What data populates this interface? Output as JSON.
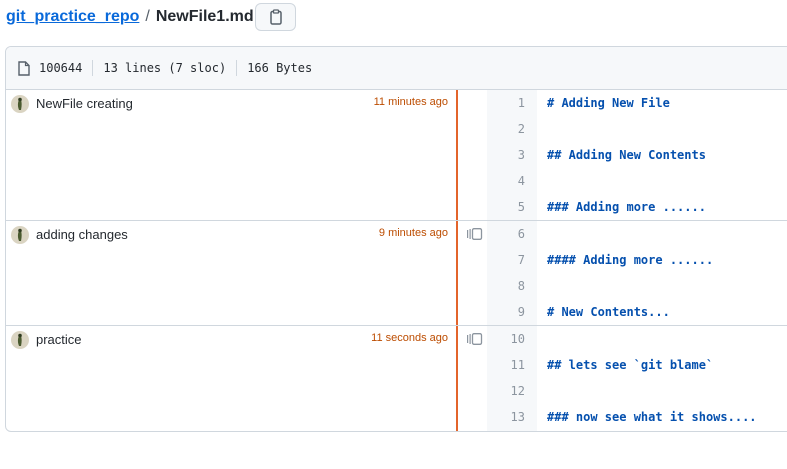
{
  "breadcrumb": {
    "repo": "git_practice_repo",
    "separator": "/",
    "file": "NewFile1.md"
  },
  "file_info": {
    "mode": "100644",
    "lines": "13 lines (7 sloc)",
    "size": "166 Bytes"
  },
  "blame": {
    "hunks": [
      {
        "message": "NewFile creating",
        "age": "11 minutes ago"
      },
      {
        "message": "adding changes",
        "age": "9 minutes ago"
      },
      {
        "message": "practice",
        "age": "11 seconds ago"
      }
    ],
    "lines": [
      {
        "num": "1",
        "text": "# Adding New File"
      },
      {
        "num": "2",
        "text": ""
      },
      {
        "num": "3",
        "text": "## Adding New Contents"
      },
      {
        "num": "4",
        "text": ""
      },
      {
        "num": "5",
        "text": "### Adding more ......"
      },
      {
        "num": "6",
        "text": ""
      },
      {
        "num": "7",
        "text": "#### Adding more ......"
      },
      {
        "num": "8",
        "text": ""
      },
      {
        "num": "9",
        "text": "# New Contents..."
      },
      {
        "num": "10",
        "text": ""
      },
      {
        "num": "11",
        "text": "## lets see `git blame`"
      },
      {
        "num": "12",
        "text": ""
      },
      {
        "num": "13",
        "text": "### now see what it shows...."
      }
    ]
  },
  "colors": {
    "link": "#0969da",
    "age": "#bc4c00",
    "blame_bar": "#e3642b",
    "code": "#0550ae"
  },
  "icons": {
    "copy": "clipboard-icon",
    "file": "file-icon",
    "reblame": "versions-icon"
  }
}
